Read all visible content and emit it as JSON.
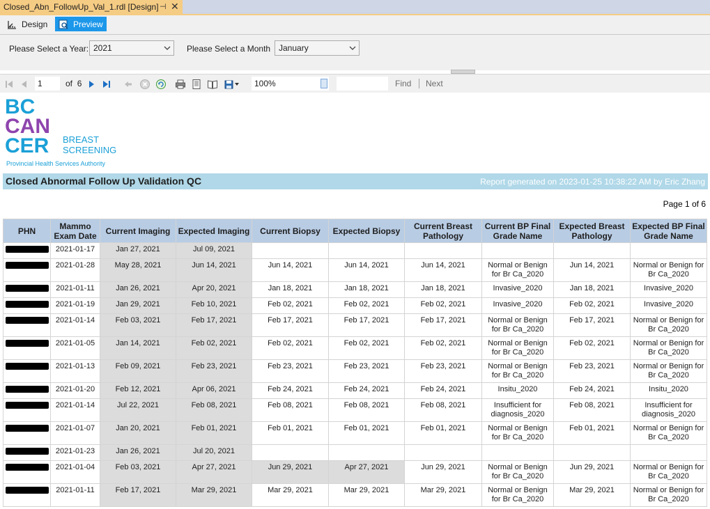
{
  "window": {
    "tab_title": "Closed_Abn_FollowUp_Val_1.rdl [Design]",
    "pin_glyph": "⊣",
    "close_glyph": "✕"
  },
  "modes": {
    "design_label": "Design",
    "preview_label": "Preview",
    "active": "Preview"
  },
  "parameters": {
    "year_label": "Please Select a Year:",
    "year_value": "2021",
    "month_label": "Please Select a Month",
    "month_value": "January"
  },
  "toolbar": {
    "page_current": "1",
    "page_of": "of",
    "page_total": "6",
    "zoom_value": "100%",
    "find_label": "Find",
    "next_label": "Next",
    "icons": [
      "first-page-icon",
      "prev-page-icon",
      "next-page-icon",
      "last-page-icon",
      "back-icon",
      "stop-icon",
      "refresh-icon",
      "print-icon",
      "print-layout-icon",
      "page-setup-icon",
      "export-icon"
    ]
  },
  "logo": {
    "line1": "BC",
    "line2": "CAN",
    "line3": "CER",
    "breast": "BREAST",
    "screening": "SCREENING",
    "authority": "Provincial Health Services Authority"
  },
  "report": {
    "title": "Closed Abnormal Follow Up Validation QC",
    "generated": "Report generated on 2023-01-25 10:38:22 AM by Eric Zhang",
    "page_label": "Page 1 of 6"
  },
  "colors": {
    "tab_active": "#f5cc84",
    "preview_accent": "#1c97ea",
    "title_bar": "#b0d8e8",
    "header_bg": "#b8cce4",
    "grey_cell": "#dcdcdc",
    "logo_blue": "#1ba0d7",
    "logo_purple": "#8e44ad"
  },
  "table": {
    "headers": [
      "PHN",
      "Mammo Exam Date",
      "Current Imaging",
      "Expected Imaging",
      "Current Biopsy",
      "Expected Biopsy",
      "Current Breast Pathology",
      "Current BP Final Grade Name",
      "Expected Breast Pathology",
      "Expected BP Final Grade Name"
    ],
    "rows": [
      {
        "exam": "2021-01-17",
        "cur_img": "Jan 27, 2021",
        "exp_img": "Jul 09, 2021",
        "cur_bx": "",
        "exp_bx": "",
        "cur_bp": "",
        "cur_grade": "",
        "exp_bp": "",
        "exp_grade": "",
        "grey_bx": false
      },
      {
        "exam": "2021-01-28",
        "cur_img": "May 28, 2021",
        "exp_img": "Jun 14, 2021",
        "cur_bx": "Jun 14, 2021",
        "exp_bx": "Jun 14, 2021",
        "cur_bp": "Jun 14, 2021",
        "cur_grade": "Normal or Benign for Br Ca_2020",
        "exp_bp": "Jun 14, 2021",
        "exp_grade": "Normal or Benign for Br Ca_2020",
        "grey_bx": false
      },
      {
        "exam": "2021-01-11",
        "cur_img": "Jan 26, 2021",
        "exp_img": "Apr 20, 2021",
        "cur_bx": "Jan 18, 2021",
        "exp_bx": "Jan 18, 2021",
        "cur_bp": "Jan 18, 2021",
        "cur_grade": "Invasive_2020",
        "exp_bp": "Jan 18, 2021",
        "exp_grade": "Invasive_2020",
        "grey_bx": false
      },
      {
        "exam": "2021-01-19",
        "cur_img": "Jan 29, 2021",
        "exp_img": "Feb 10, 2021",
        "cur_bx": "Feb 02, 2021",
        "exp_bx": "Feb 02, 2021",
        "cur_bp": "Feb 02, 2021",
        "cur_grade": "Invasive_2020",
        "exp_bp": "Feb 02, 2021",
        "exp_grade": "Invasive_2020",
        "grey_bx": false
      },
      {
        "exam": "2021-01-14",
        "cur_img": "Feb 03, 2021",
        "exp_img": "Feb 17, 2021",
        "cur_bx": "Feb 17, 2021",
        "exp_bx": "Feb 17, 2021",
        "cur_bp": "Feb 17, 2021",
        "cur_grade": "Normal or Benign for Br Ca_2020",
        "exp_bp": "Feb 17, 2021",
        "exp_grade": "Normal or Benign for Br Ca_2020",
        "grey_bx": false
      },
      {
        "exam": "2021-01-05",
        "cur_img": "Jan 14, 2021",
        "exp_img": "Feb 02, 2021",
        "cur_bx": "Feb 02, 2021",
        "exp_bx": "Feb 02, 2021",
        "cur_bp": "Feb 02, 2021",
        "cur_grade": "Normal or Benign for Br Ca_2020",
        "exp_bp": "Feb 02, 2021",
        "exp_grade": "Normal or Benign for Br Ca_2020",
        "grey_bx": false
      },
      {
        "exam": "2021-01-13",
        "cur_img": "Feb 09, 2021",
        "exp_img": "Feb 23, 2021",
        "cur_bx": "Feb 23, 2021",
        "exp_bx": "Feb 23, 2021",
        "cur_bp": "Feb 23, 2021",
        "cur_grade": "Normal or Benign for Br Ca_2020",
        "exp_bp": "Feb 23, 2021",
        "exp_grade": "Normal or Benign for Br Ca_2020",
        "grey_bx": false
      },
      {
        "exam": "2021-01-20",
        "cur_img": "Feb 12, 2021",
        "exp_img": "Apr 06, 2021",
        "cur_bx": "Feb 24, 2021",
        "exp_bx": "Feb 24, 2021",
        "cur_bp": "Feb 24, 2021",
        "cur_grade": "Insitu_2020",
        "exp_bp": "Feb 24, 2021",
        "exp_grade": "Insitu_2020",
        "grey_bx": false
      },
      {
        "exam": "2021-01-14",
        "cur_img": "Jul 22, 2021",
        "exp_img": "Feb 08, 2021",
        "cur_bx": "Feb 08, 2021",
        "exp_bx": "Feb 08, 2021",
        "cur_bp": "Feb 08, 2021",
        "cur_grade": "Insufficient for diagnosis_2020",
        "exp_bp": "Feb 08, 2021",
        "exp_grade": "Insufficient for diagnosis_2020",
        "grey_bx": false
      },
      {
        "exam": "2021-01-07",
        "cur_img": "Jan 20, 2021",
        "exp_img": "Feb 01, 2021",
        "cur_bx": "Feb 01, 2021",
        "exp_bx": "Feb 01, 2021",
        "cur_bp": "Feb 01, 2021",
        "cur_grade": "Normal or Benign for Br Ca_2020",
        "exp_bp": "Feb 01, 2021",
        "exp_grade": "Normal or Benign for Br Ca_2020",
        "grey_bx": false
      },
      {
        "exam": "2021-01-23",
        "cur_img": "Jan 26, 2021",
        "exp_img": "Jul 20, 2021",
        "cur_bx": "",
        "exp_bx": "",
        "cur_bp": "",
        "cur_grade": "",
        "exp_bp": "",
        "exp_grade": "",
        "grey_bx": false
      },
      {
        "exam": "2021-01-04",
        "cur_img": "Feb 03, 2021",
        "exp_img": "Apr 27, 2021",
        "cur_bx": "Jun 29, 2021",
        "exp_bx": "Apr 27, 2021",
        "cur_bp": "Jun 29, 2021",
        "cur_grade": "Normal or Benign for Br Ca_2020",
        "exp_bp": "Jun 29, 2021",
        "exp_grade": "Normal or Benign for Br Ca_2020",
        "grey_bx": true
      },
      {
        "exam": "2021-01-11",
        "cur_img": "Feb 17, 2021",
        "exp_img": "Mar 29, 2021",
        "cur_bx": "Mar 29, 2021",
        "exp_bx": "Mar 29, 2021",
        "cur_bp": "Mar 29, 2021",
        "cur_grade": "Normal or Benign for Br Ca_2020",
        "exp_bp": "Mar 29, 2021",
        "exp_grade": "Normal or Benign for Br Ca_2020",
        "grey_bx": false
      }
    ]
  }
}
